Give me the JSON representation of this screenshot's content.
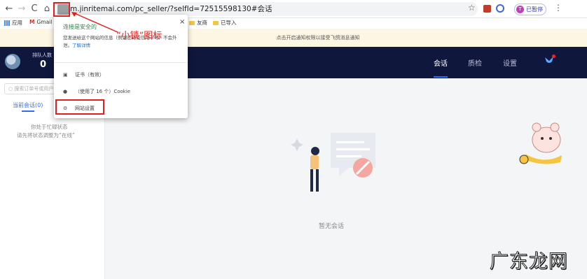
{
  "browser": {
    "url": "m.jinritemai.com/pc_seller/?selfId=72515598130#会话",
    "profile_label": "已暂停",
    "profile_initial": "T",
    "nav": {
      "back": "←",
      "forward": "→",
      "reload": "C",
      "home": "⌂",
      "star": "☆",
      "menu": "⋮"
    }
  },
  "bookmarks": {
    "apps_label": "应用",
    "gmail_label": "Gmail",
    "items": [
      "友商",
      "已导入"
    ]
  },
  "notice": "点击开启通知权限以接受飞鸽消息通知",
  "header": {
    "queue_label": "排队人数",
    "queue_value": "0",
    "tabs": [
      "会话",
      "质检",
      "设置"
    ]
  },
  "sidebar": {
    "search_placeholder": "搜索订单号或用户",
    "tab_current": "当前会话(0)",
    "busy_line1": "你处于忙碌状态",
    "busy_line2": "请先将状态调整为“在线”"
  },
  "main": {
    "empty_text": "暂无会话"
  },
  "popup": {
    "title": "连接是安全的",
    "desc": "您发送给这个网站的信息（例如密码或信用卡号）不会外泄。",
    "learn_more": "了解详情",
    "certificate": "证书（有效）",
    "cookie": "（使用了 16 个）Cookie",
    "site_settings": "网站设置",
    "close": "×"
  },
  "annotation": "“小锁”图标",
  "watermark": "广东龙网",
  "colors": {
    "header_bg": "#10173c",
    "accent": "#2f6bff",
    "annotation_red": "#e0201c",
    "secure_green": "#1e8e3e"
  }
}
